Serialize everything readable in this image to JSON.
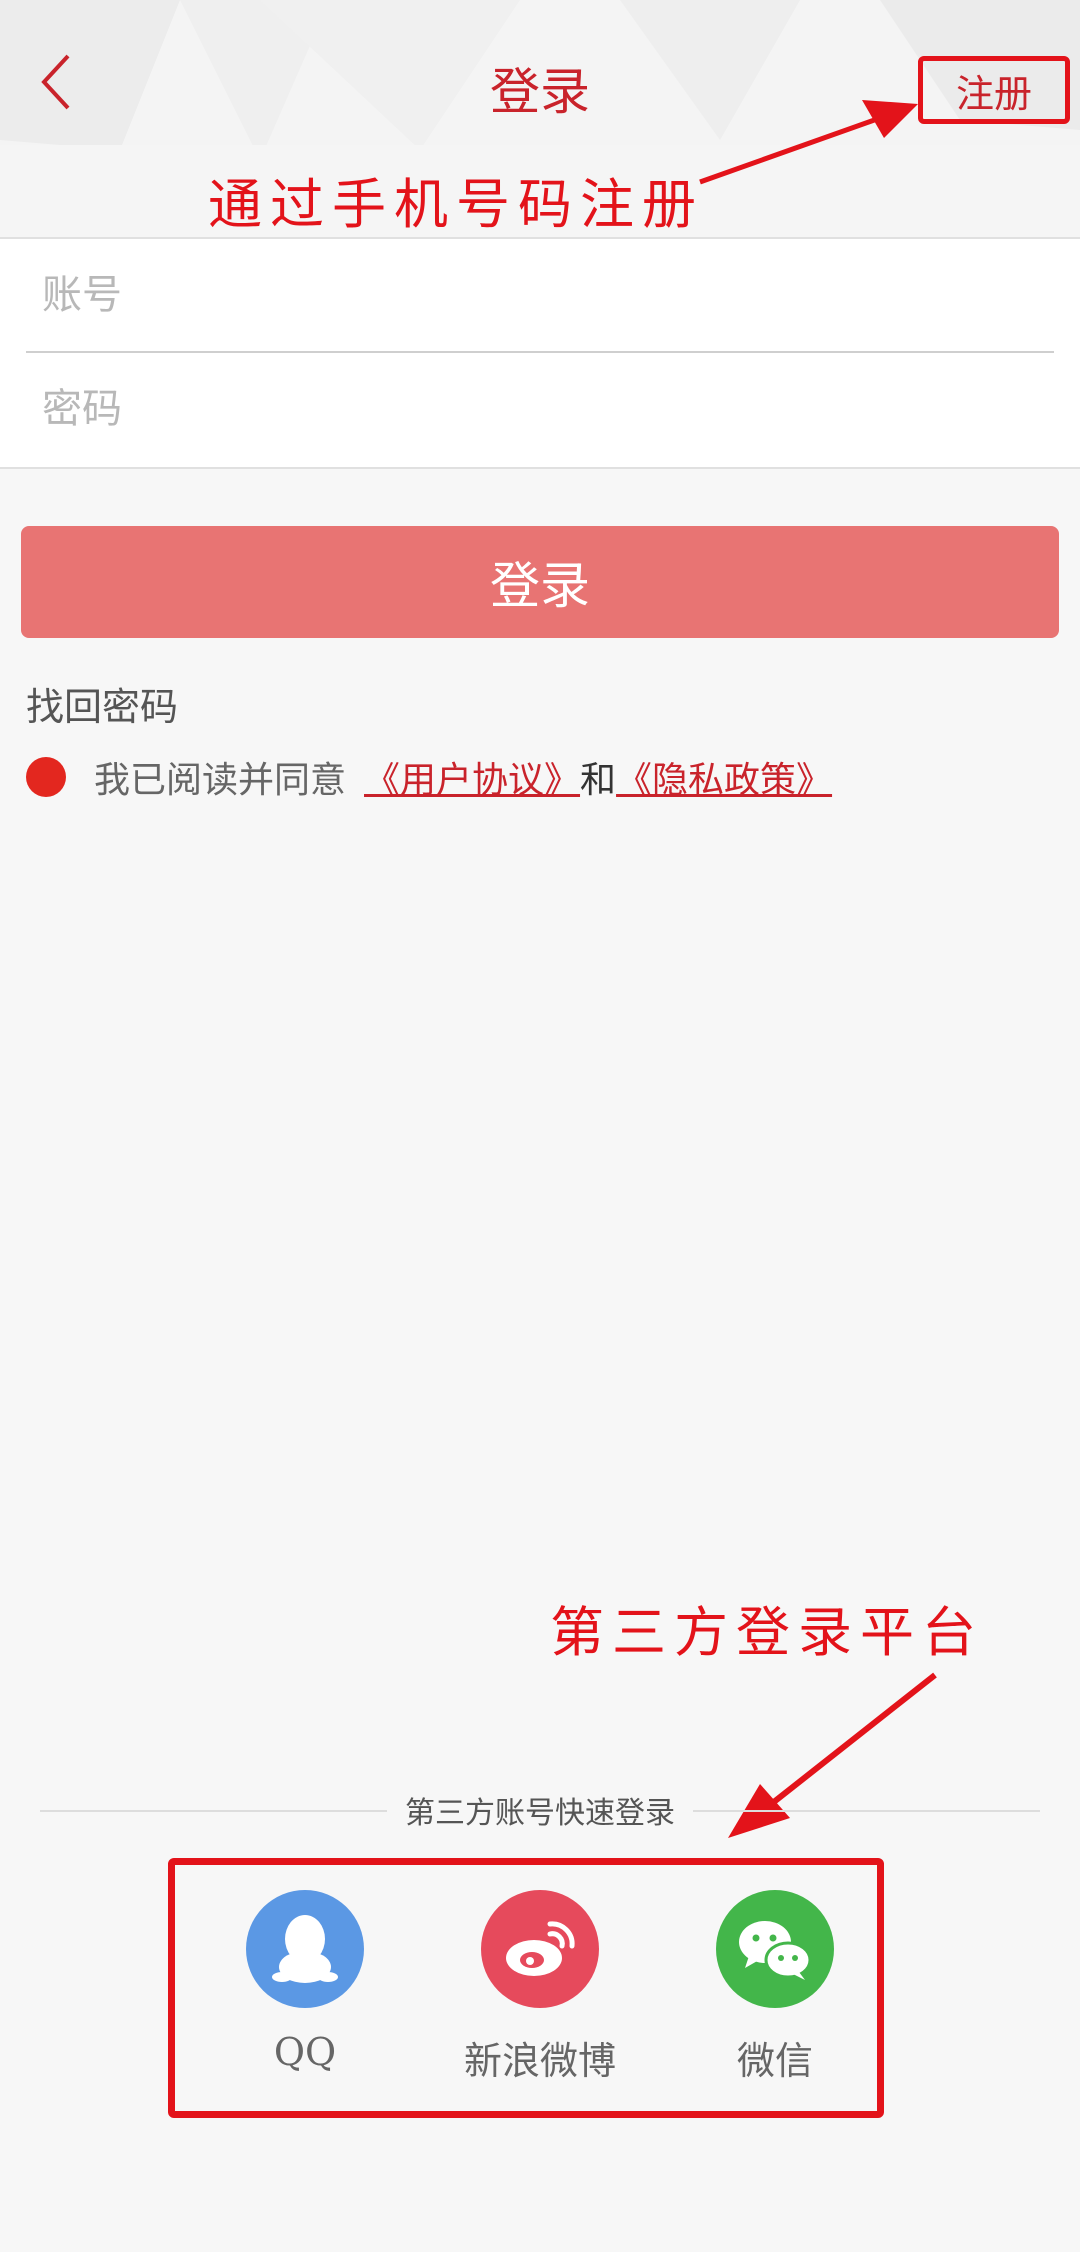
{
  "header": {
    "title": "登录",
    "register_label": "注册"
  },
  "annotations": {
    "register_hint": "通过手机号码注册",
    "third_party_hint": "第三方登录平台",
    "color": "#e3131a"
  },
  "form": {
    "account_placeholder": "账号",
    "password_placeholder": "密码",
    "login_button": "登录",
    "forgot_password": "找回密码"
  },
  "agreement": {
    "prefix": "我已阅读并同意",
    "user_agreement": "《用户协议》",
    "and": "和",
    "privacy_policy": "《隐私政策》"
  },
  "third_party": {
    "title": "第三方账号快速登录",
    "items": [
      {
        "label": "QQ",
        "icon": "qq-icon",
        "color": "#5b98e4"
      },
      {
        "label": "新浪微博",
        "icon": "weibo-icon",
        "color": "#e64a5c"
      },
      {
        "label": "微信",
        "icon": "wechat-icon",
        "color": "#43b64a"
      }
    ]
  },
  "colors": {
    "brand_red": "#c9232b",
    "login_button_bg": "#e87473"
  }
}
